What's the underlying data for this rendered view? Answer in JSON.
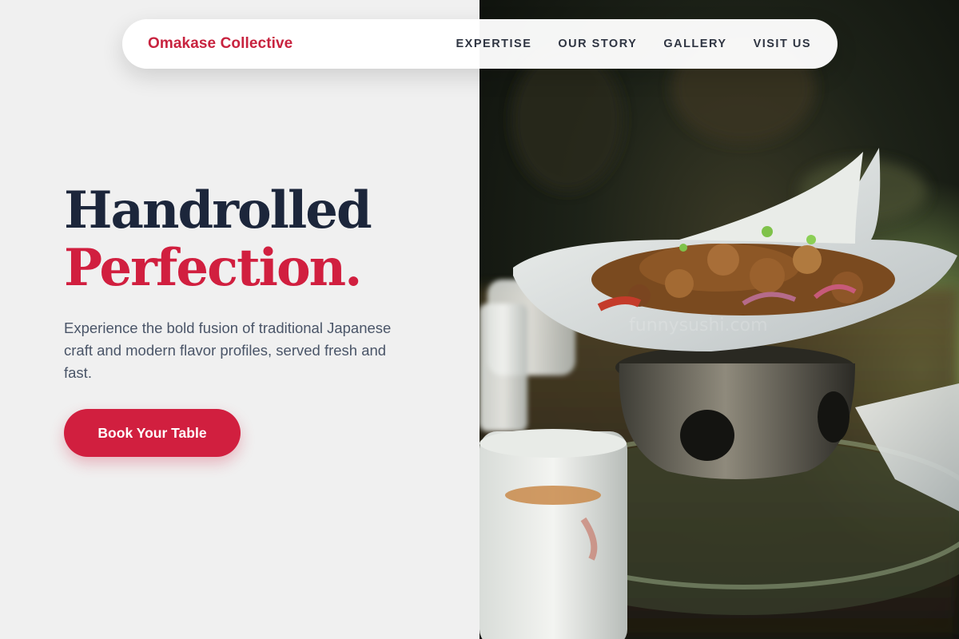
{
  "brand": {
    "name": "Omakase Collective",
    "accent": "#d11f3f"
  },
  "nav": {
    "items": [
      {
        "label": "EXPERTISE"
      },
      {
        "label": "OUR STORY"
      },
      {
        "label": "GALLERY"
      },
      {
        "label": "VISIT US"
      }
    ]
  },
  "hero": {
    "title_line1": "Handrolled",
    "title_line2": "Perfection.",
    "description": "Experience the bold fusion of traditional Japanese craft and modern flavor profiles, served fresh and fast.",
    "cta_label": "Book Your Table"
  },
  "photo": {
    "subject": "stir-fried dish on a white plate over a metal warmer",
    "watermark": "funnysushi.com"
  },
  "colors": {
    "title_dark": "#1c263b",
    "text_muted": "#4a5568",
    "left_bg": "#f0f0f0"
  }
}
